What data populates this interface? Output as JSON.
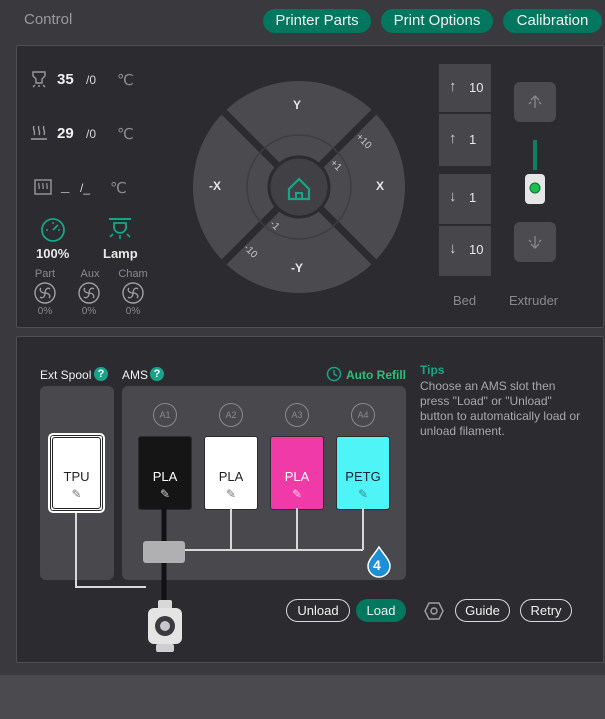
{
  "header": {
    "title": "Control",
    "buttons": {
      "printer_parts": "Printer Parts",
      "print_options": "Print Options",
      "calibration": "Calibration"
    }
  },
  "temps": {
    "nozzle": {
      "value": "35",
      "target": "/0",
      "unit": "℃"
    },
    "bed": {
      "value": "29",
      "target": "/0",
      "unit": "℃"
    },
    "chamber": {
      "value": "_",
      "target": "/_",
      "unit": "℃"
    }
  },
  "speed": {
    "value": "100%"
  },
  "lamp": {
    "label": "Lamp"
  },
  "fans": [
    {
      "label": "Part",
      "value": "0%"
    },
    {
      "label": "Aux",
      "value": "0%"
    },
    {
      "label": "Cham",
      "value": "0%"
    }
  ],
  "jog": {
    "y_plus": "Y",
    "y_minus": "-Y",
    "x_plus": "X",
    "x_minus": "-X",
    "step_large_plus": "+10",
    "step_small_plus": "+1",
    "step_small_minus": "-1",
    "step_large_minus": "-10"
  },
  "bed_z": {
    "up10": "10",
    "up1": "1",
    "down1": "1",
    "down10": "10",
    "label": "Bed"
  },
  "extruder": {
    "label": "Extruder"
  },
  "filament": {
    "ext_spool_label": "Ext Spool",
    "ams_label": "AMS",
    "help": "?",
    "auto_refill": "Auto Refill",
    "ext_spool_material": "TPU",
    "slots": [
      {
        "id": "A1",
        "material": "PLA",
        "color": "#151515"
      },
      {
        "id": "A2",
        "material": "PLA",
        "color": "#ffffff"
      },
      {
        "id": "A3",
        "material": "PLA",
        "color": "#f03aa8"
      },
      {
        "id": "A4",
        "material": "PETG",
        "color": "#4ef4f6"
      }
    ],
    "ams_badge": "4",
    "tips_title": "Tips",
    "tips_text": "Choose an AMS slot then press \"Load\" or \"Unload\" button to automatically load or unload filament."
  },
  "actions": {
    "unload": "Unload",
    "load": "Load",
    "guide": "Guide",
    "retry": "Retry"
  },
  "colors": {
    "accent": "#00775e",
    "background": "#2c2c30"
  }
}
